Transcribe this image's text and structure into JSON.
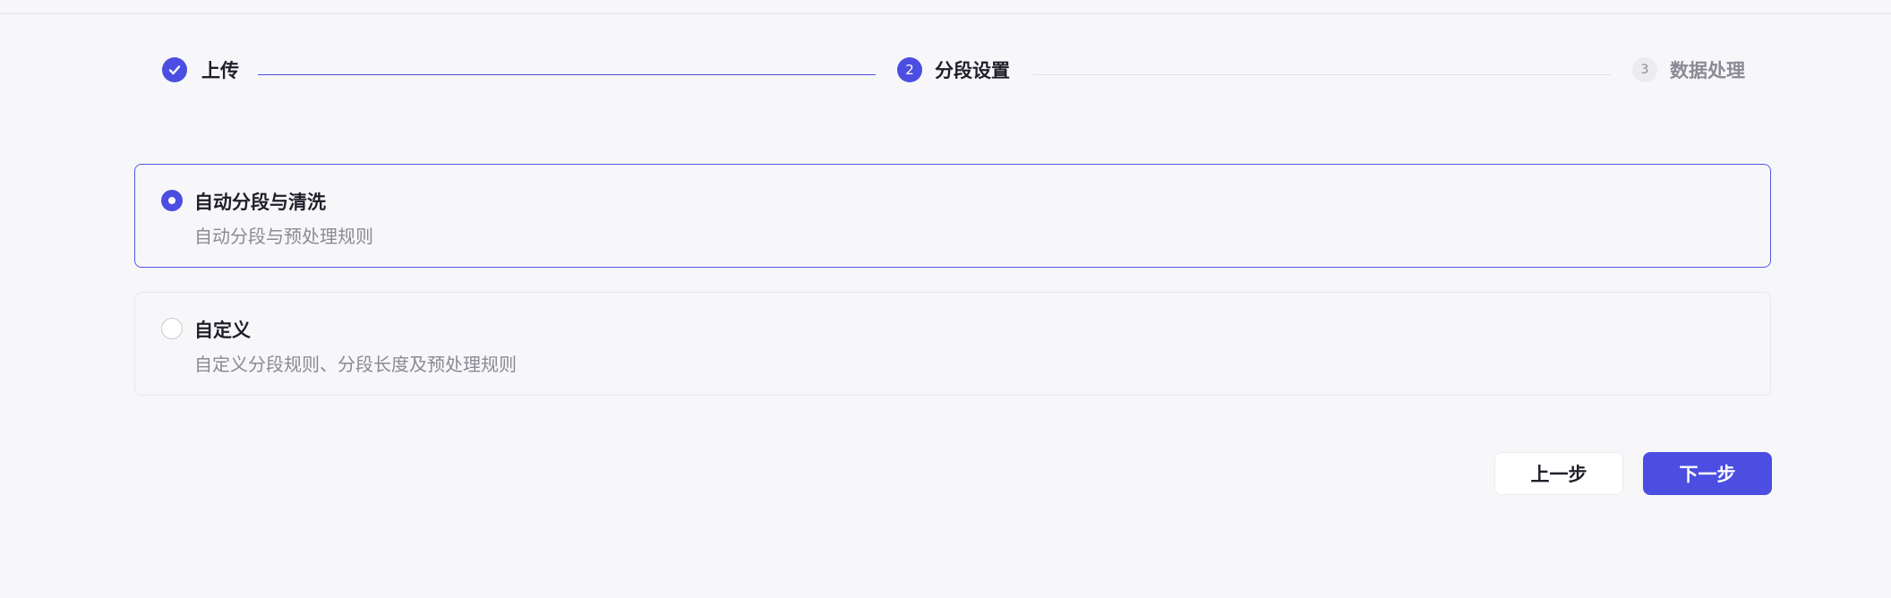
{
  "stepper": {
    "steps": [
      {
        "label": "上传",
        "status": "done",
        "icon": "check-icon"
      },
      {
        "label": "分段设置",
        "number": "2",
        "status": "current"
      },
      {
        "label": "数据处理",
        "number": "3",
        "status": "pending"
      }
    ]
  },
  "options": [
    {
      "title": "自动分段与清洗",
      "description": "自动分段与预处理规则",
      "selected": true
    },
    {
      "title": "自定义",
      "description": "自定义分段规则、分段长度及预处理规则",
      "selected": false
    }
  ],
  "actions": {
    "prev_label": "上一步",
    "next_label": "下一步"
  },
  "colors": {
    "accent": "#4b4ee0",
    "background": "#f7f7f9",
    "text": "#1f1f2a",
    "muted": "#8a8a93"
  }
}
